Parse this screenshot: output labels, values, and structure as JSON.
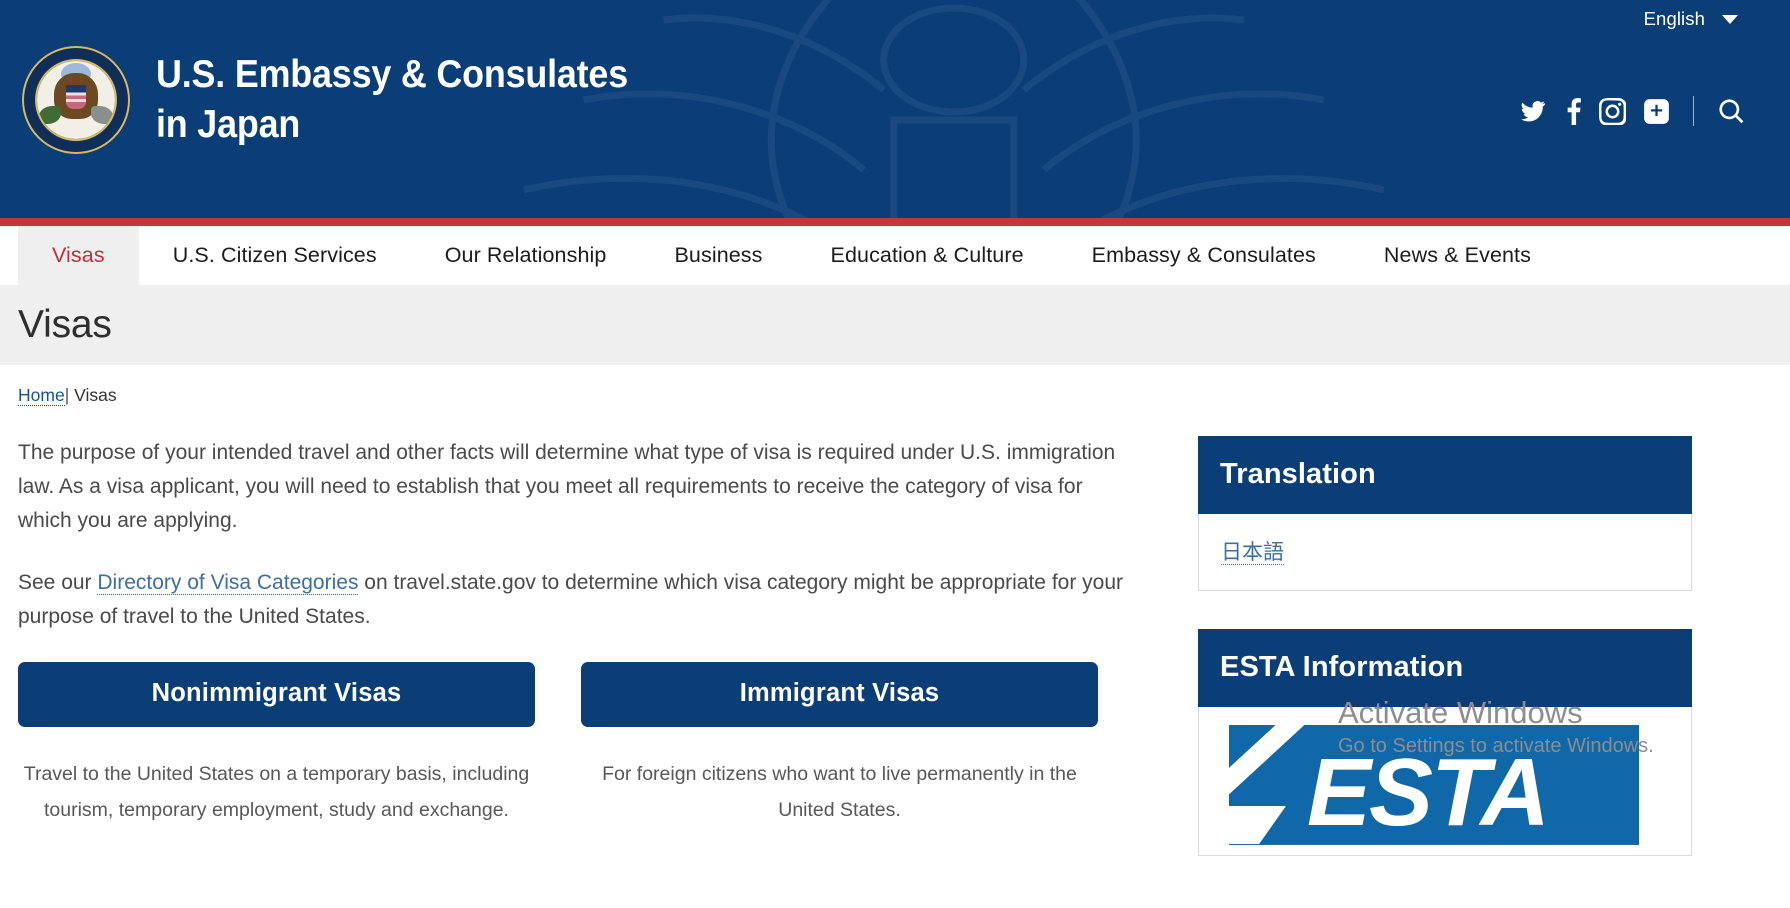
{
  "header": {
    "language_label": "English",
    "language_icon": "chevron-down-icon",
    "seal_alt": "department-of-state-seal",
    "site_title_line1": "U.S. Embassy & Consulates",
    "site_title_line2": "in Japan",
    "social": [
      {
        "name": "twitter-icon",
        "label": "Twitter"
      },
      {
        "name": "facebook-icon",
        "label": "Facebook"
      },
      {
        "name": "instagram-icon",
        "label": "Instagram"
      },
      {
        "name": "share-plus-icon",
        "label": "More"
      }
    ],
    "search_icon": "search-icon",
    "colors": {
      "header_blue": "#0b3d76",
      "red_stripe": "#c3353f",
      "active_tab_bg": "#efefef",
      "active_tab_text": "#c0303a",
      "link_blue": "#3d6ea6"
    }
  },
  "nav": {
    "items": [
      {
        "label": "Visas",
        "active": true
      },
      {
        "label": "U.S. Citizen Services",
        "active": false
      },
      {
        "label": "Our Relationship",
        "active": false
      },
      {
        "label": "Business",
        "active": false
      },
      {
        "label": "Education & Culture",
        "active": false
      },
      {
        "label": "Embassy & Consulates",
        "active": false
      },
      {
        "label": "News & Events",
        "active": false
      }
    ]
  },
  "page": {
    "title": "Visas",
    "breadcrumb": {
      "home": "Home",
      "separator": "|",
      "current": "Visas"
    }
  },
  "main": {
    "paragraph1": "The purpose of your intended travel and other facts will determine what type of visa is required under U.S. immigration law. As a visa applicant, you will need to establish that you meet all requirements to receive the category of visa for which you are applying.",
    "paragraph2_before": "See our ",
    "paragraph2_link": "Directory of Visa Categories",
    "paragraph2_after": " on travel.state.gov to determine which visa category might be appropriate for your purpose of travel to the United States.",
    "cards": [
      {
        "button_label": "Nonimmigrant Visas",
        "description": "Travel to the United States on a temporary basis, including tourism, temporary employment, study and exchange."
      },
      {
        "button_label": "Immigrant Visas",
        "description": "For foreign citizens who want to live permanently in the United States."
      }
    ]
  },
  "sidebar": {
    "widgets": [
      {
        "title": "Translation",
        "link_label": "日本語"
      },
      {
        "title": "ESTA Information",
        "image_label": "ESTA"
      }
    ]
  },
  "watermark": {
    "title": "Activate Windows",
    "subtitle": "Go to Settings to activate Windows."
  }
}
